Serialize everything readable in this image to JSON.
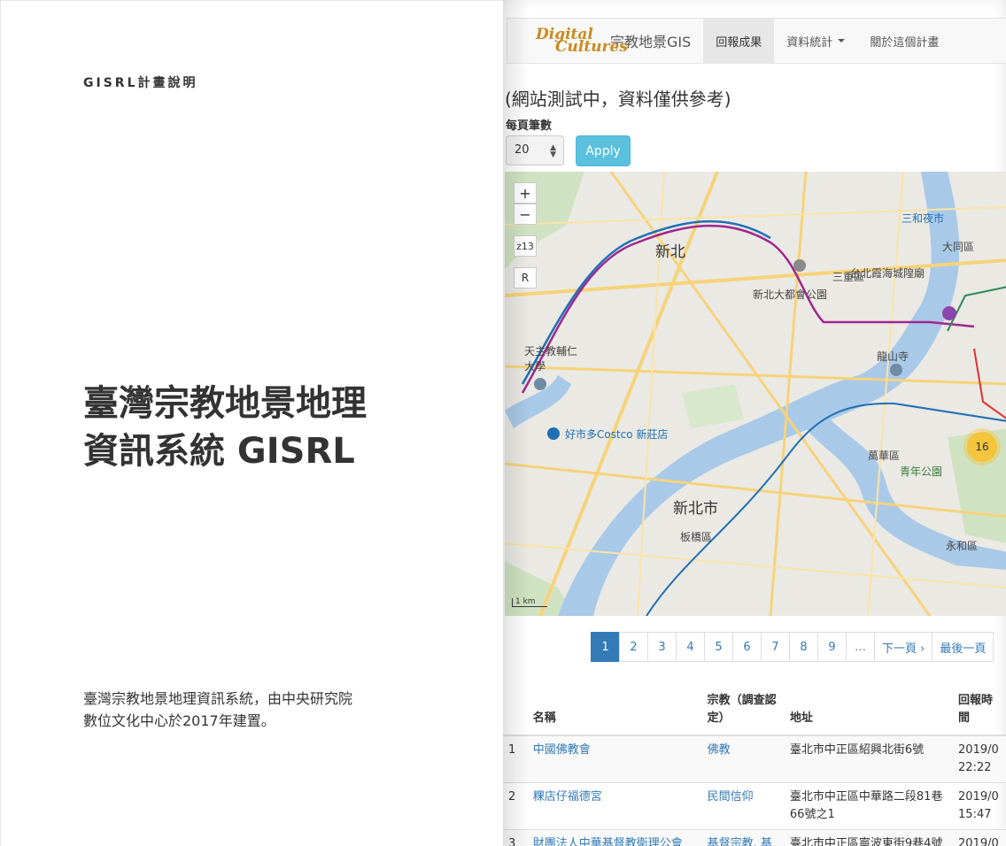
{
  "left": {
    "eyebrow": "GISRL計畫說明",
    "title_line1": "臺灣宗教地景地理",
    "title_line2": "資訊系統 GISRL",
    "desc_line1": "臺灣宗教地景地理資訊系統，由中央研究院",
    "desc_line2": "數位文化中心於2017年建置。"
  },
  "navbar": {
    "logo_line1": "Digital",
    "logo_line2": "Cultures",
    "brand": "宗教地景GIS",
    "items": [
      {
        "label": "回報成果"
      },
      {
        "label": "資料統計"
      },
      {
        "label": "關於這個計畫"
      }
    ]
  },
  "notice": "(網站測試中，資料僅供參考)",
  "perpage": {
    "label": "每頁筆數",
    "value": "20",
    "apply": "Apply"
  },
  "map": {
    "zoom_in": "+",
    "zoom_out": "−",
    "zoom_level": "z13",
    "reset": "R",
    "scale": "1 km",
    "labels": {
      "xinbei_district": "新北",
      "xinbei_city": "新北市",
      "banqiao": "板橋區",
      "sanchong": "三重區",
      "costco": "好市多Costco 新莊店",
      "fujen": "天主教輔仁大學",
      "wanhua": "萬華區",
      "yonghe": "永和區",
      "qingnian": "青年公園",
      "dalong": "大同區",
      "longshan": "龍山寺",
      "sanhe": "三和夜市",
      "xiahai": "台北霞海城隍廟",
      "dadou": "新北大都會公園"
    },
    "cluster_count": "16"
  },
  "pager": {
    "pages": [
      "1",
      "2",
      "3",
      "4",
      "5",
      "6",
      "7",
      "8",
      "9"
    ],
    "active": "1",
    "ellipsis": "…",
    "next": "下一頁 ›",
    "last": "最後一頁"
  },
  "table": {
    "headers": [
      "",
      "名稱",
      "宗教（調查認定）",
      "地址",
      "回報時間"
    ],
    "rows": [
      {
        "no": "1",
        "name": "中國佛教會",
        "religion": "佛教",
        "address": "臺北市中正區紹興北街6號",
        "time": "2019/0 22:22"
      },
      {
        "no": "2",
        "name": "粿店仔福德宮",
        "religion": "民間信仰",
        "address": "臺北市中正區中華路二段81巷66號之1",
        "time": "2019/0 15:47"
      },
      {
        "no": "3",
        "name": "財團法人中華基督教衛理公會",
        "religion": "基督宗教, 基",
        "address": "臺北市中正區寧波東街9巷4號",
        "time": "2019/0"
      }
    ]
  }
}
